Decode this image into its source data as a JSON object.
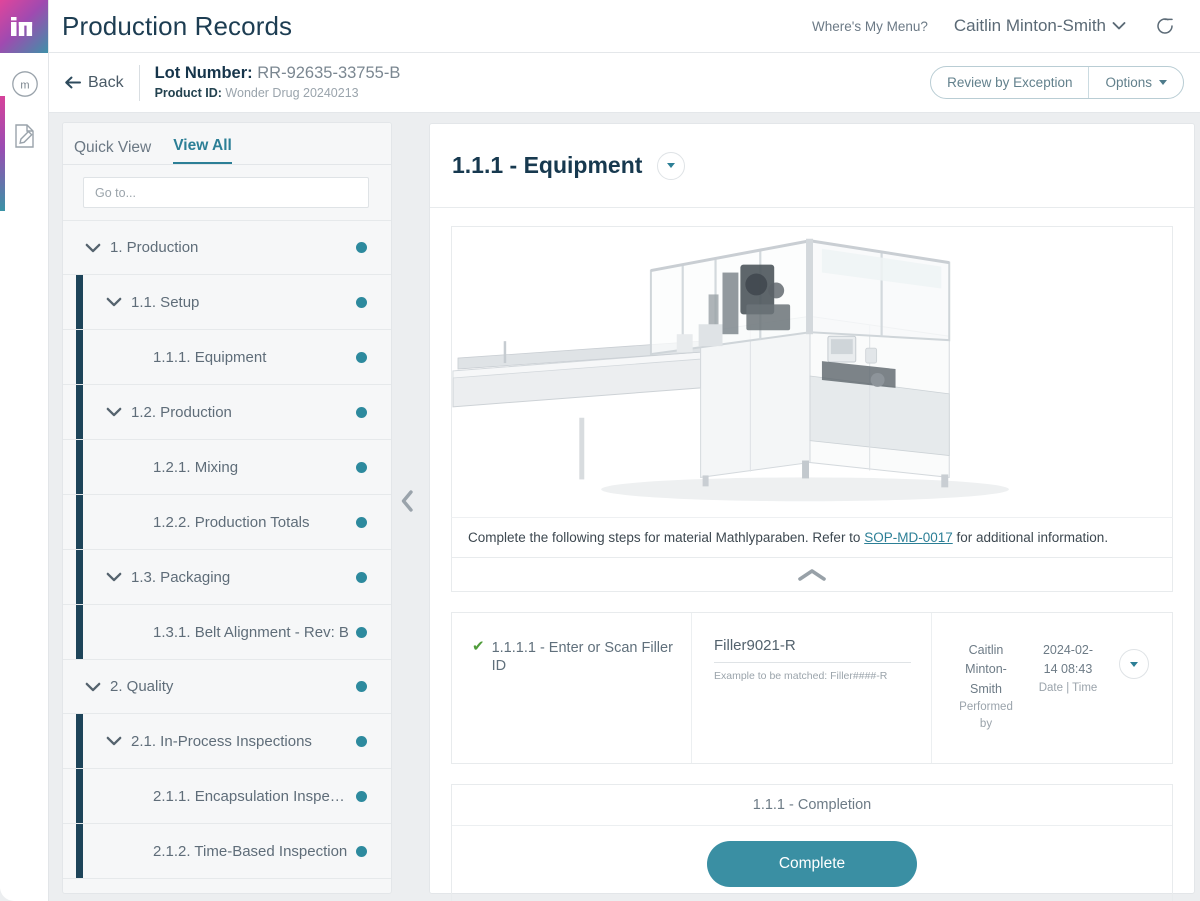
{
  "brand": {
    "logo_mark": "m-logo-icon",
    "gradient_from": "#e0459b",
    "gradient_to": "#3d92a8",
    "accent_teal": "#2d8a9e",
    "dark_navy": "#1d4459"
  },
  "header": {
    "app_title": "Production Records",
    "wheres_my_menu": "Where's My Menu?",
    "user_name": "Caitlin Minton-Smith",
    "refresh_icon": "refresh-icon",
    "user_caret_icon": "chevron-down-icon"
  },
  "lotbar": {
    "back_label": "Back",
    "back_icon": "arrow-left-icon",
    "lot_label": "Lot Number:",
    "lot_value": "RR-92635-33755-B",
    "product_label": "Product ID:",
    "product_value": "Wonder Drug 20240213",
    "review_by_exception": "Review by Exception",
    "options": "Options",
    "options_caret_icon": "caret-down-icon"
  },
  "sidebar": {
    "tabs": [
      {
        "label": "Quick View",
        "active": false
      },
      {
        "label": "View All",
        "active": true
      }
    ],
    "search_placeholder": "Go to...",
    "search_value": "",
    "collapse_icon": "chevron-left-icon",
    "tree": [
      {
        "level": 1,
        "label": "1. Production",
        "expandable": true,
        "status": "teal"
      },
      {
        "level": 2,
        "label": "1.1. Setup",
        "expandable": true,
        "status": "teal"
      },
      {
        "level": 3,
        "label": "1.1.1. Equipment",
        "expandable": false,
        "status": "teal"
      },
      {
        "level": 2,
        "label": "1.2. Production",
        "expandable": true,
        "status": "teal"
      },
      {
        "level": 3,
        "label": "1.2.1. Mixing",
        "expandable": false,
        "status": "teal"
      },
      {
        "level": 3,
        "label": "1.2.2. Production Totals",
        "expandable": false,
        "status": "teal"
      },
      {
        "level": 2,
        "label": "1.3. Packaging",
        "expandable": true,
        "status": "teal"
      },
      {
        "level": 3,
        "label": "1.3.1. Belt Alignment - Rev: B",
        "expandable": false,
        "status": "teal"
      },
      {
        "level": 1,
        "label": "2. Quality",
        "expandable": true,
        "status": "teal"
      },
      {
        "level": 2,
        "label": "2.1. In-Process Inspections",
        "expandable": true,
        "status": "teal"
      },
      {
        "level": 3,
        "label": "2.1.1. Encapsulation Inspect...",
        "expandable": false,
        "status": "teal"
      },
      {
        "level": 3,
        "label": "2.1.2. Time-Based Inspection",
        "expandable": false,
        "status": "teal"
      }
    ]
  },
  "main": {
    "section_title": "1.1.1 - Equipment",
    "section_caret_icon": "caret-down-icon",
    "media_alt": "packaging-equipment-photo",
    "instruction_pre": "Complete the following steps for material Mathlyparaben. Refer to ",
    "instruction_link": "SOP-MD-0017",
    "instruction_post": " for additional information.",
    "collapse_media_icon": "chevron-up-icon",
    "step": {
      "check_icon": "checkmark-icon",
      "label": "1.1.1.1 - Enter or Scan Filler ID",
      "value": "Filler9021-R",
      "hint": "Example to be matched: Filler####-R",
      "performed_by_value": "Caitlin Minton-Smith",
      "performed_by_label": "Performed by",
      "datetime_value": "2024-02-14 08:43",
      "datetime_label": "Date | Time",
      "row_caret_icon": "caret-down-icon"
    },
    "completion": {
      "title": "1.1.1 - Completion",
      "button_label": "Complete",
      "button_color": "#3a8fa3"
    }
  }
}
